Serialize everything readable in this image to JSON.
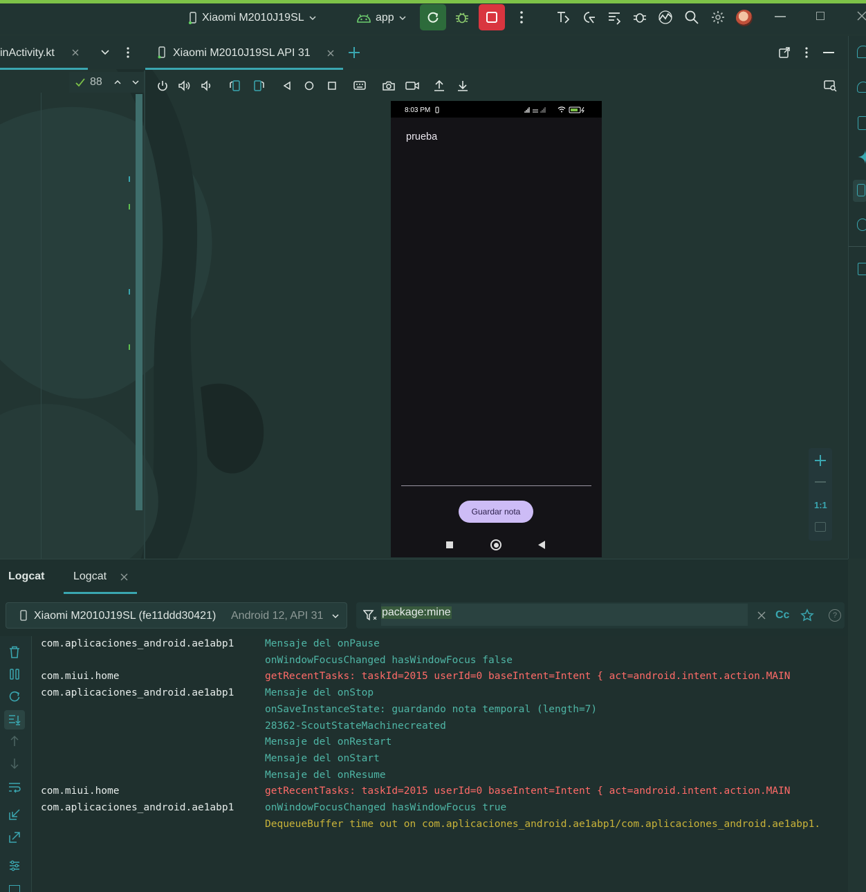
{
  "toolbar": {
    "device_name": "Xiaomi M2010J19SL",
    "run_config": "app",
    "run_button_color": "#2d6b3b",
    "stop_button_color": "#d9353f",
    "accent_color": "#7dc248"
  },
  "editor_tabs": {
    "file_tab_label": "inActivity.kt",
    "device_tab_label": "Xiaomi M2010J19SL API 31"
  },
  "gutter": {
    "inspection_count": "88"
  },
  "phone": {
    "status_time": "8:03 PM",
    "note_text": "prueba",
    "save_button_label": "Guardar nota",
    "save_button_color": "#cdbcf6"
  },
  "zoom": {
    "zoom_label": "1:1"
  },
  "logcat": {
    "panel_title": "Logcat",
    "tab_label": "Logcat",
    "device_label": "Xiaomi M2010J19SL (fe11ddd30421)",
    "device_sub": "Android 12, API 31",
    "filter_query": "package:mine",
    "case_toggle_label": "Cc",
    "colors": {
      "debug": "#4fb6a6",
      "error": "#ff6b68",
      "warn": "#c9b339"
    },
    "rows": [
      {
        "pkg": "com.aplicaciones_android.ae1abp1",
        "msg": "Mensaje del onPause",
        "level": "d"
      },
      {
        "pkg": "",
        "msg": "onWindowFocusChanged hasWindowFocus false",
        "level": "d"
      },
      {
        "pkg": "com.miui.home",
        "msg": "getRecentTasks: taskId=2015   userId=0   baseIntent=Intent { act=android.intent.action.MAIN",
        "level": "e"
      },
      {
        "pkg": "com.aplicaciones_android.ae1abp1",
        "msg": "Mensaje del onStop",
        "level": "d"
      },
      {
        "pkg": "",
        "msg": "onSaveInstanceState: guardando nota temporal (length=7)",
        "level": "d"
      },
      {
        "pkg": "",
        "msg": "28362-ScoutStateMachinecreated",
        "level": "d"
      },
      {
        "pkg": "",
        "msg": "Mensaje del onRestart",
        "level": "d"
      },
      {
        "pkg": "",
        "msg": "Mensaje del onStart",
        "level": "d"
      },
      {
        "pkg": "",
        "msg": "Mensaje del onResume",
        "level": "d"
      },
      {
        "pkg": "com.miui.home",
        "msg": "getRecentTasks: taskId=2015   userId=0   baseIntent=Intent { act=android.intent.action.MAIN",
        "level": "e"
      },
      {
        "pkg": "com.aplicaciones_android.ae1abp1",
        "msg": "onWindowFocusChanged hasWindowFocus true",
        "level": "d"
      },
      {
        "pkg": "",
        "msg": "DequeueBuffer time out on com.aplicaciones_android.ae1abp1/com.aplicaciones_android.ae1abp1.",
        "level": "w"
      }
    ]
  }
}
